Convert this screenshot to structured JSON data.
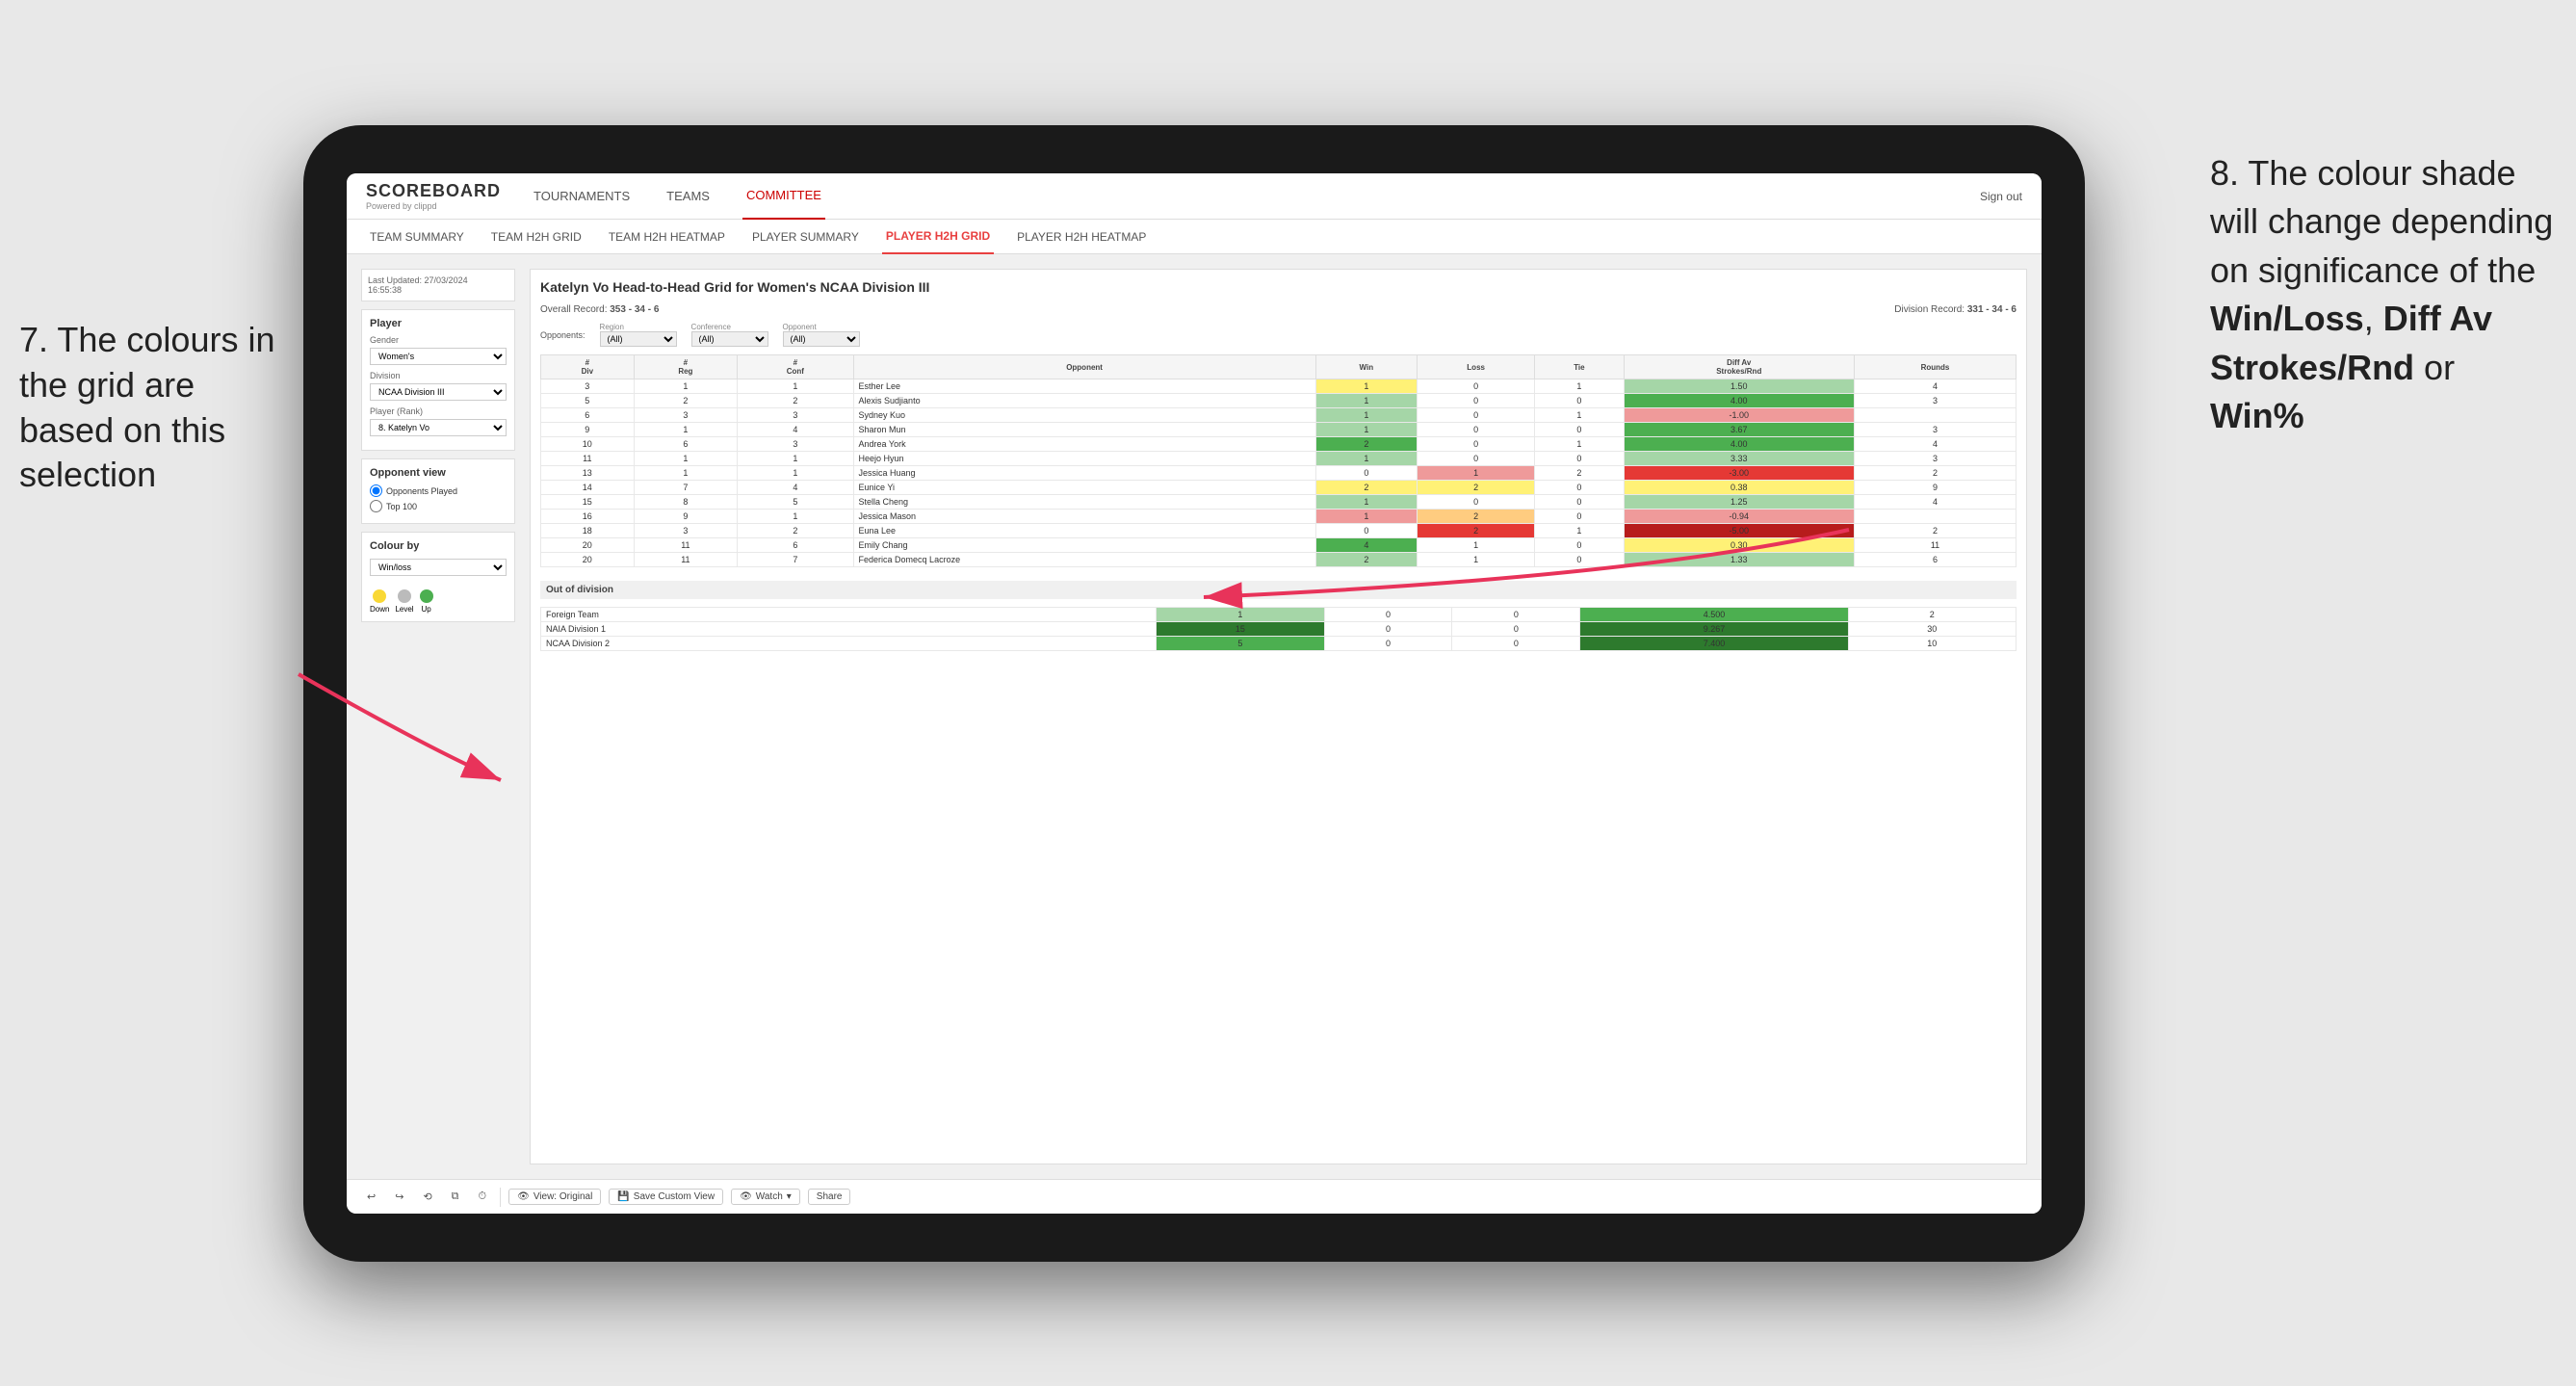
{
  "annotations": {
    "left": "7. The colours in the grid are based on this selection",
    "right_intro": "8. The colour shade will change depending on significance of the ",
    "right_bold1": "Win/Loss",
    "right_sep1": ", ",
    "right_bold2": "Diff Av Strokes/Rnd",
    "right_sep2": " or ",
    "right_bold3": "Win%"
  },
  "nav": {
    "logo": "SCOREBOARD",
    "logo_sub": "Powered by clippd",
    "items": [
      "TOURNAMENTS",
      "TEAMS",
      "COMMITTEE"
    ],
    "active": "COMMITTEE",
    "sign_out": "Sign out"
  },
  "sub_nav": {
    "items": [
      "TEAM SUMMARY",
      "TEAM H2H GRID",
      "TEAM H2H HEATMAP",
      "PLAYER SUMMARY",
      "PLAYER H2H GRID",
      "PLAYER H2H HEATMAP"
    ],
    "active": "PLAYER H2H GRID"
  },
  "left_panel": {
    "last_updated_label": "Last Updated: 27/03/2024",
    "last_updated_time": "16:55:38",
    "player_section_title": "Player",
    "gender_label": "Gender",
    "gender_value": "Women's",
    "division_label": "Division",
    "division_value": "NCAA Division III",
    "player_rank_label": "Player (Rank)",
    "player_rank_value": "8. Katelyn Vo",
    "opponent_view_title": "Opponent view",
    "radio1": "Opponents Played",
    "radio2": "Top 100",
    "colour_by_title": "Colour by",
    "colour_by_value": "Win/loss",
    "legend_down": "Down",
    "legend_level": "Level",
    "legend_up": "Up"
  },
  "grid": {
    "title": "Katelyn Vo Head-to-Head Grid for Women's NCAA Division III",
    "overall_record_label": "Overall Record:",
    "overall_record_value": "353 - 34 - 6",
    "division_record_label": "Division Record:",
    "division_record_value": "331 - 34 - 6",
    "opponents_label": "Opponents:",
    "opponents_value": "(All)",
    "region_label": "Region",
    "region_value": "(All)",
    "conference_label": "Conference",
    "conference_value": "(All)",
    "opponent_label": "Opponent",
    "opponent_value": "(All)",
    "col_headers": [
      "#\nDiv",
      "#\nReg",
      "#\nConf",
      "Opponent",
      "Win",
      "Loss",
      "Tie",
      "Diff Av\nStrokes/Rnd",
      "Rounds"
    ],
    "rows": [
      {
        "div": "3",
        "reg": "1",
        "conf": "1",
        "opponent": "Esther Lee",
        "win": 1,
        "loss": 0,
        "tie": 1,
        "diff": "1.50",
        "rounds": 4,
        "win_color": "cell-yellow",
        "loss_color": "cell-neutral",
        "tie_color": "cell-neutral",
        "diff_color": "cell-green-light"
      },
      {
        "div": "5",
        "reg": "2",
        "conf": "2",
        "opponent": "Alexis Sudjianto",
        "win": 1,
        "loss": 0,
        "tie": 0,
        "diff": "4.00",
        "rounds": 3,
        "win_color": "cell-green-light",
        "loss_color": "cell-neutral",
        "tie_color": "cell-neutral",
        "diff_color": "cell-green-med"
      },
      {
        "div": "6",
        "reg": "3",
        "conf": "3",
        "opponent": "Sydney Kuo",
        "win": 1,
        "loss": 0,
        "tie": 1,
        "diff": "-1.00",
        "rounds": "",
        "win_color": "cell-green-light",
        "loss_color": "cell-neutral",
        "tie_color": "cell-neutral",
        "diff_color": "cell-red-light"
      },
      {
        "div": "9",
        "reg": "1",
        "conf": "4",
        "opponent": "Sharon Mun",
        "win": 1,
        "loss": 0,
        "tie": 0,
        "diff": "3.67",
        "rounds": 3,
        "win_color": "cell-green-light",
        "loss_color": "cell-neutral",
        "tie_color": "cell-neutral",
        "diff_color": "cell-green-med"
      },
      {
        "div": "10",
        "reg": "6",
        "conf": "3",
        "opponent": "Andrea York",
        "win": 2,
        "loss": 0,
        "tie": 1,
        "diff": "4.00",
        "rounds": 4,
        "win_color": "cell-green-med",
        "loss_color": "cell-neutral",
        "tie_color": "cell-neutral",
        "diff_color": "cell-green-med"
      },
      {
        "div": "11",
        "reg": "1",
        "conf": "1",
        "opponent": "Heejo Hyun",
        "win": 1,
        "loss": 0,
        "tie": 0,
        "diff": "3.33",
        "rounds": 3,
        "win_color": "cell-green-light",
        "loss_color": "cell-neutral",
        "tie_color": "cell-neutral",
        "diff_color": "cell-green-light"
      },
      {
        "div": "13",
        "reg": "1",
        "conf": "1",
        "opponent": "Jessica Huang",
        "win": 0,
        "loss": 1,
        "tie": 2,
        "diff": "-3.00",
        "rounds": 2,
        "win_color": "cell-neutral",
        "loss_color": "cell-red-light",
        "tie_color": "cell-neutral",
        "diff_color": "cell-red"
      },
      {
        "div": "14",
        "reg": "7",
        "conf": "4",
        "opponent": "Eunice Yi",
        "win": 2,
        "loss": 2,
        "tie": 0,
        "diff": "0.38",
        "rounds": 9,
        "win_color": "cell-yellow",
        "loss_color": "cell-yellow",
        "tie_color": "cell-neutral",
        "diff_color": "cell-yellow"
      },
      {
        "div": "15",
        "reg": "8",
        "conf": "5",
        "opponent": "Stella Cheng",
        "win": 1,
        "loss": 0,
        "tie": 0,
        "diff": "1.25",
        "rounds": 4,
        "win_color": "cell-green-light",
        "loss_color": "cell-neutral",
        "tie_color": "cell-neutral",
        "diff_color": "cell-green-light"
      },
      {
        "div": "16",
        "reg": "9",
        "conf": "1",
        "opponent": "Jessica Mason",
        "win": 1,
        "loss": 2,
        "tie": 0,
        "diff": "-0.94",
        "rounds": "",
        "win_color": "cell-red-light",
        "loss_color": "cell-orange-light",
        "tie_color": "cell-neutral",
        "diff_color": "cell-red-light"
      },
      {
        "div": "18",
        "reg": "3",
        "conf": "2",
        "opponent": "Euna Lee",
        "win": 0,
        "loss": 2,
        "tie": 1,
        "diff": "-5.00",
        "rounds": 2,
        "win_color": "cell-neutral",
        "loss_color": "cell-red",
        "tie_color": "cell-neutral",
        "diff_color": "cell-red-dark"
      },
      {
        "div": "20",
        "reg": "11",
        "conf": "6",
        "opponent": "Emily Chang",
        "win": 4,
        "loss": 1,
        "tie": 0,
        "diff": "0.30",
        "rounds": 11,
        "win_color": "cell-green-med",
        "loss_color": "cell-neutral",
        "tie_color": "cell-neutral",
        "diff_color": "cell-yellow"
      },
      {
        "div": "20",
        "reg": "11",
        "conf": "7",
        "opponent": "Federica Domecq Lacroze",
        "win": 2,
        "loss": 1,
        "tie": 0,
        "diff": "1.33",
        "rounds": 6,
        "win_color": "cell-green-light",
        "loss_color": "cell-neutral",
        "tie_color": "cell-neutral",
        "diff_color": "cell-green-light"
      }
    ],
    "out_of_division_header": "Out of division",
    "out_of_division_rows": [
      {
        "label": "Foreign Team",
        "win": 1,
        "loss": 0,
        "tie": 0,
        "diff": "4.500",
        "rounds": 2,
        "win_color": "cell-green-light",
        "diff_color": "cell-green-med"
      },
      {
        "label": "NAIA Division 1",
        "win": 15,
        "loss": 0,
        "tie": 0,
        "diff": "9.267",
        "rounds": 30,
        "win_color": "cell-green-dark",
        "diff_color": "cell-green-dark"
      },
      {
        "label": "NCAA Division 2",
        "win": 5,
        "loss": 0,
        "tie": 0,
        "diff": "7.400",
        "rounds": 10,
        "win_color": "cell-green-med",
        "diff_color": "cell-green-dark"
      }
    ]
  },
  "toolbar": {
    "view_original": "View: Original",
    "save_custom": "Save Custom View",
    "watch": "Watch",
    "share": "Share"
  }
}
